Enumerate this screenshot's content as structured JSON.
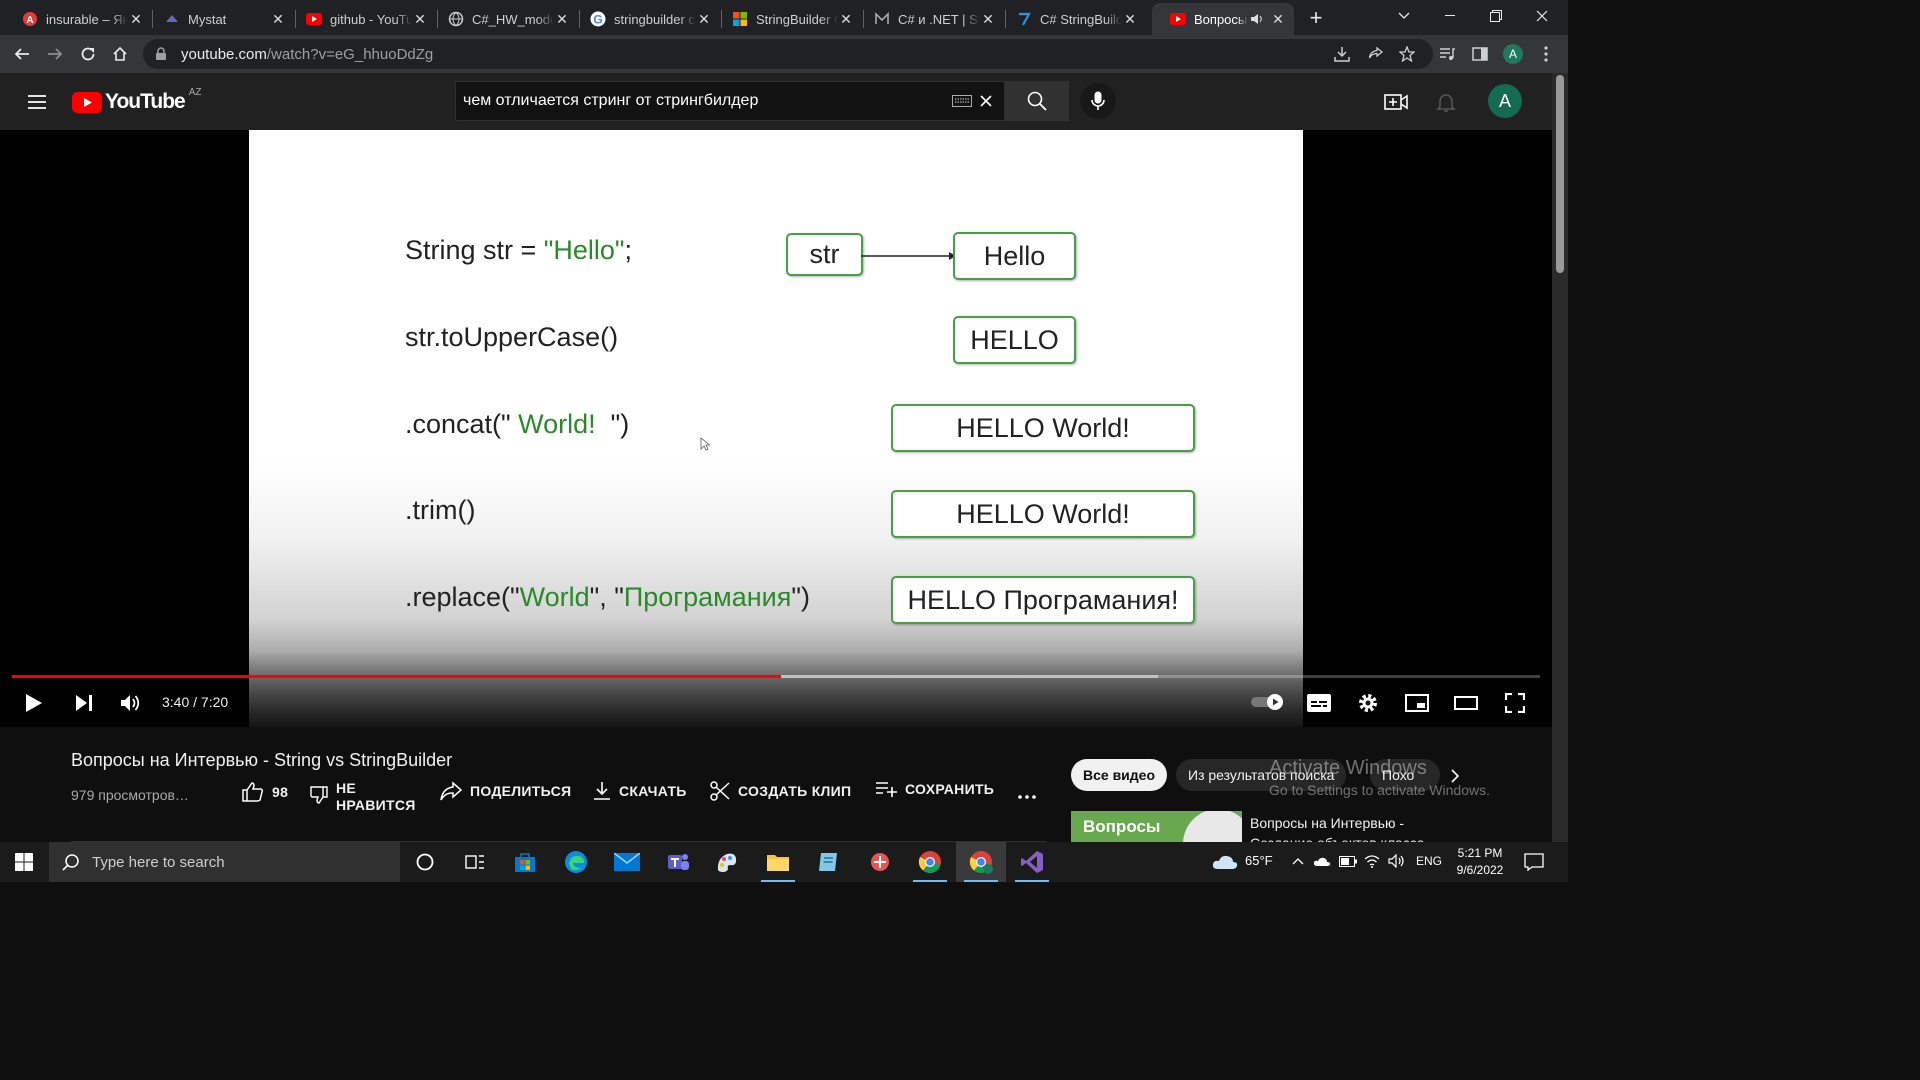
{
  "browser": {
    "tabs": [
      {
        "title": "insurable – Ян",
        "icon": "yandex-translate-icon"
      },
      {
        "title": "Mystat",
        "icon": "mystat-icon"
      },
      {
        "title": "github - YouTu",
        "icon": "youtube-icon"
      },
      {
        "title": "C#_HW_modu",
        "icon": "globe-icon"
      },
      {
        "title": "stringbuilder c",
        "icon": "google-icon"
      },
      {
        "title": "StringBuilder C",
        "icon": "microsoft-icon"
      },
      {
        "title": "C# и .NET | Str",
        "icon": "metanit-icon"
      },
      {
        "title": "C# StringBuild",
        "icon": "edge-docs-icon"
      },
      {
        "title": "Вопросы",
        "icon": "youtube-icon",
        "active": true,
        "audio": true
      }
    ],
    "url_host": "youtube.com",
    "url_path": "/watch?v=eG_hhuoDdZg",
    "profile_initial": "A"
  },
  "youtube": {
    "logo_text": "YouTube",
    "country_code": "AZ",
    "search_value": "чем отличается стринг от стрингбилдер",
    "avatar_initial": "A"
  },
  "slide": {
    "lines": [
      {
        "pre": "String str = ",
        "green": "\"Hello\"",
        "post": ";"
      },
      {
        "pre": "str.toUpperCase()",
        "green": "",
        "post": ""
      },
      {
        "pre": ".concat(\"",
        "green": " World!  ",
        "post": "\")"
      },
      {
        "pre": ".trim()",
        "green": "",
        "post": ""
      },
      {
        "pre": ".replace(\"",
        "green": "World",
        "post": "\", \"",
        "green2": "Програмания",
        "post2": "\")"
      }
    ],
    "ref_box": "str",
    "boxes": [
      "Hello",
      "HELLO",
      "HELLO World!",
      "HELLO World!",
      "HELLO Програмания!"
    ]
  },
  "player": {
    "time_current": "3:40",
    "time_total": "7:20",
    "played_fraction": 0.503,
    "buffered_fraction": 0.75
  },
  "video": {
    "title": "Вопросы на Интервью - String vs StringBuilder",
    "views": "979 просмотров…",
    "likes": "98",
    "dislike_label": "НЕ НРАВИТСЯ",
    "dislike_line1": "НЕ",
    "dislike_line2": "НРАВИТСЯ",
    "share_label": "ПОДЕЛИТЬСЯ",
    "download_label": "СКАЧАТЬ",
    "clip_label": "СОЗДАТЬ КЛИП",
    "save_label": "СОХРАНИТЬ"
  },
  "recommendations": {
    "chips": [
      "Все видео",
      "Из результатов поиска",
      "Похо"
    ],
    "first_thumb_text": "Вопросы",
    "first_title": "Вопросы на Интервью - Создание объектов класса"
  },
  "watermark": {
    "line1": "Activate Windows",
    "line2": "Go to Settings to activate Windows."
  },
  "taskbar": {
    "search_placeholder": "Type here to search",
    "weather": "65°F",
    "language": "ENG",
    "time": "5:21 PM",
    "date": "9/6/2022"
  },
  "colors": {
    "accent_red": "#ff0000",
    "slide_green_text": "#2a8a2a",
    "slide_box_border": "#46a046"
  }
}
